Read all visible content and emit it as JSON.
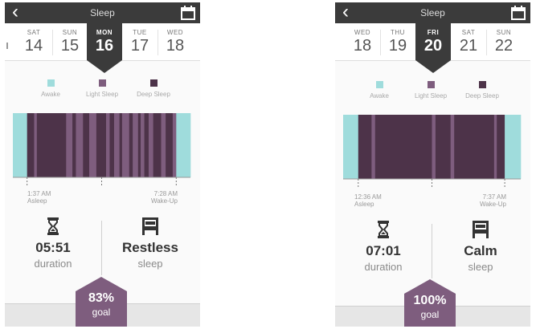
{
  "screens": [
    {
      "title": "Sleep",
      "dates": [
        {
          "dow": "SAT",
          "num": "14"
        },
        {
          "dow": "SUN",
          "num": "15"
        },
        {
          "dow": "MON",
          "num": "16"
        },
        {
          "dow": "TUE",
          "num": "17"
        },
        {
          "dow": "WED",
          "num": "18"
        }
      ],
      "selected_index": 2,
      "legend": [
        {
          "label": "Awake",
          "color": "#9fdcdc"
        },
        {
          "label": "Light Sleep",
          "color": "#7e5d7e"
        },
        {
          "label": "Deep Sleep",
          "color": "#4d3349"
        }
      ],
      "chart_data": {
        "type": "bar",
        "segments": [
          {
            "stage": "awake",
            "start": 0.0,
            "end": 0.08
          },
          {
            "stage": "deep",
            "start": 0.08,
            "end": 0.12
          },
          {
            "stage": "light",
            "start": 0.12,
            "end": 0.135
          },
          {
            "stage": "deep",
            "start": 0.135,
            "end": 0.3
          },
          {
            "stage": "light",
            "start": 0.3,
            "end": 0.335
          },
          {
            "stage": "deep",
            "start": 0.335,
            "end": 0.355
          },
          {
            "stage": "light",
            "start": 0.355,
            "end": 0.395
          },
          {
            "stage": "deep",
            "start": 0.395,
            "end": 0.43
          },
          {
            "stage": "light",
            "start": 0.43,
            "end": 0.47
          },
          {
            "stage": "deep",
            "start": 0.47,
            "end": 0.525
          },
          {
            "stage": "light",
            "start": 0.525,
            "end": 0.545
          },
          {
            "stage": "deep",
            "start": 0.545,
            "end": 0.57
          },
          {
            "stage": "light",
            "start": 0.57,
            "end": 0.6
          },
          {
            "stage": "deep",
            "start": 0.6,
            "end": 0.615
          },
          {
            "stage": "light",
            "start": 0.615,
            "end": 0.655
          },
          {
            "stage": "deep",
            "start": 0.655,
            "end": 0.675
          },
          {
            "stage": "light",
            "start": 0.675,
            "end": 0.705
          },
          {
            "stage": "deep",
            "start": 0.705,
            "end": 0.72
          },
          {
            "stage": "light",
            "start": 0.72,
            "end": 0.74
          },
          {
            "stage": "deep",
            "start": 0.74,
            "end": 0.765
          },
          {
            "stage": "light",
            "start": 0.765,
            "end": 0.79
          },
          {
            "stage": "deep",
            "start": 0.79,
            "end": 0.835
          },
          {
            "stage": "light",
            "start": 0.835,
            "end": 0.86
          },
          {
            "stage": "deep",
            "start": 0.86,
            "end": 0.9
          },
          {
            "stage": "light",
            "start": 0.9,
            "end": 0.92
          },
          {
            "stage": "awake",
            "start": 0.92,
            "end": 1.0
          }
        ]
      },
      "asleep_time": "1:37 AM",
      "asleep_label": "Asleep",
      "wake_time": "7:28 AM",
      "wake_label": "Wake-Up",
      "duration_value": "05:51",
      "duration_label": "duration",
      "quality_value": "Restless",
      "quality_label": "sleep",
      "goal_value": "83%",
      "goal_label": "goal",
      "header_icon": "chevron-left-icon",
      "calendar_icon": "calendar-icon"
    },
    {
      "title": "Sleep",
      "dates": [
        {
          "dow": "WED",
          "num": "18"
        },
        {
          "dow": "THU",
          "num": "19"
        },
        {
          "dow": "FRI",
          "num": "20"
        },
        {
          "dow": "SAT",
          "num": "21"
        },
        {
          "dow": "SUN",
          "num": "22"
        }
      ],
      "selected_index": 2,
      "legend": [
        {
          "label": "Awake",
          "color": "#9fdcdc"
        },
        {
          "label": "Light Sleep",
          "color": "#7e5d7e"
        },
        {
          "label": "Deep Sleep",
          "color": "#4d3349"
        }
      ],
      "chart_data": {
        "type": "bar",
        "segments": [
          {
            "stage": "awake",
            "start": 0.0,
            "end": 0.085
          },
          {
            "stage": "deep",
            "start": 0.085,
            "end": 0.16
          },
          {
            "stage": "light",
            "start": 0.16,
            "end": 0.18
          },
          {
            "stage": "deep",
            "start": 0.18,
            "end": 0.5
          },
          {
            "stage": "light",
            "start": 0.5,
            "end": 0.52
          },
          {
            "stage": "deep",
            "start": 0.52,
            "end": 0.605
          },
          {
            "stage": "light",
            "start": 0.605,
            "end": 0.625
          },
          {
            "stage": "deep",
            "start": 0.625,
            "end": 0.85
          },
          {
            "stage": "light",
            "start": 0.85,
            "end": 0.865
          },
          {
            "stage": "deep",
            "start": 0.865,
            "end": 0.91
          },
          {
            "stage": "awake",
            "start": 0.91,
            "end": 1.0
          }
        ]
      },
      "asleep_time": "12:36 AM",
      "asleep_label": "Asleep",
      "wake_time": "7:37 AM",
      "wake_label": "Wake-Up",
      "duration_value": "07:01",
      "duration_label": "duration",
      "quality_value": "Calm",
      "quality_label": "sleep",
      "goal_value": "100%",
      "goal_label": "goal",
      "header_icon": "chevron-left-icon",
      "calendar_icon": "calendar-icon"
    }
  ]
}
